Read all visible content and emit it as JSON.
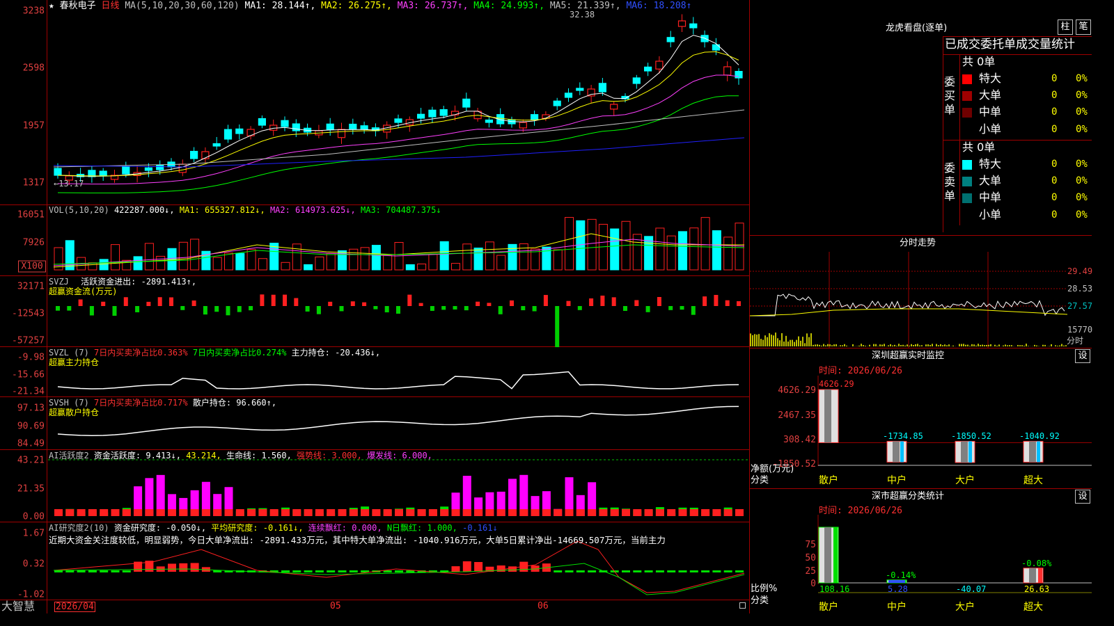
{
  "colors": {
    "up": "#ff2020",
    "down": "#00ffff",
    "ma1": "#ffffff",
    "ma2": "#ffff00",
    "ma3": "#ff40ff",
    "ma4": "#00ff00",
    "ma5": "#c0c0c0",
    "ma6": "#2020ff",
    "axis": "#a00000"
  },
  "main": {
    "star": "★",
    "stock_name": "春秋电子",
    "period": "日线",
    "ma_params": "MA(5,10,20,30,60,120)",
    "ma1": "MA1: 28.144↑,",
    "ma2": "MA2: 26.275↑,",
    "ma3": "MA3: 26.737↑,",
    "ma4": "MA4: 24.993↑,",
    "ma5": "MA5: 21.339↑,",
    "ma6": "MA6: 18.208↑",
    "high_mark": "32.38",
    "low_mark": "←13.17",
    "y_ticks": [
      "3238",
      "2598",
      "1957",
      "1317"
    ]
  },
  "vol": {
    "title": "VOL(5,10,20)",
    "value": "422287.000↓,",
    "ma1": "MA1: 655327.812↓,",
    "ma2": "MA2: 614973.625↓,",
    "ma3": "MA3: 704487.375↓",
    "y_ticks": [
      "16051",
      "7926",
      "X100"
    ]
  },
  "svzj": {
    "title": "SVZJ",
    "label": "活跃资金进出: -2891.413↑,",
    "subtitle": "超赢资金流(万元)",
    "y_ticks": [
      "32171",
      "-12543",
      "-57257"
    ]
  },
  "svzl": {
    "title": "SVZL (7)",
    "t1": "7日内买卖净占比0.363%",
    "t2": "7日内买卖净占比0.274%",
    "t3": "主力持仓: -20.436↓,",
    "subtitle": "超赢主力持仓",
    "y_ticks": [
      "-9.98",
      "-15.66",
      "-21.34"
    ]
  },
  "svsh": {
    "title": "SVSH (7)",
    "t1": "7日内买卖净占比0.717%",
    "t2": "散户持仓: 96.660↑,",
    "subtitle": "超赢散户持仓",
    "y_ticks": [
      "97.13",
      "90.69",
      "84.49"
    ]
  },
  "ai1": {
    "title": "AI活跃度2",
    "t1": "资金活跃度: 9.413↓,",
    "t2": "43.214,",
    "t3": "生命线: 1.560,",
    "t4": "强势线: 3.000,",
    "t5": "爆发线: 6.000,",
    "y_ticks": [
      "43.21",
      "21.35",
      "0.00"
    ]
  },
  "ai2": {
    "title": "AI研究度2(10)",
    "t1": "资金研究度: -0.050↓,",
    "t2": "平均研究度: -0.161↓,",
    "t3": "连续飘红: 0.000,",
    "t4": "N日飘红: 1.000,",
    "t5": "-0.161↓",
    "comment": "近期大资金关注度较低，明显弱势，今日大单净流出: -2891.433万元，其中特大单净流出: -1040.916万元，大单5日累计净出-14669.507万元，当前主力",
    "y_ticks": [
      "1.67",
      "0.32",
      "-1.02"
    ]
  },
  "bottom": {
    "brand": "大智慧",
    "dates": [
      "2026/04",
      "05",
      "06"
    ]
  },
  "lhb": {
    "title": "龙虎看盘(逐单)",
    "tab1": "柱",
    "tab2": "笔",
    "header": "已成交委托单成交量统计",
    "buy_label": "委买单",
    "sell_label": "委卖单",
    "buy_total": "共 0单",
    "sell_total": "共 0单",
    "rows": [
      {
        "name": "特大",
        "n": "0",
        "pct": "0%"
      },
      {
        "name": "大单",
        "n": "0",
        "pct": "0%"
      },
      {
        "name": "中单",
        "n": "0",
        "pct": "0%"
      },
      {
        "name": "小单",
        "n": "0",
        "pct": "0%"
      }
    ]
  },
  "fenshi": {
    "title": "分时走势",
    "y_ticks": [
      "29.49",
      "28.53",
      "27.57",
      "15770"
    ],
    "unit": "分时"
  },
  "sz_monitor": {
    "title": "深圳超赢实时监控",
    "settings": "设",
    "time": "时间: 2026/06/26",
    "y_ticks": [
      "4626.29",
      "2467.35",
      "308.42",
      "-1850.52"
    ],
    "ylabel": "净额(万元)",
    "xlabel": "分类",
    "categories": [
      "散户",
      "中户",
      "大户",
      "超大"
    ],
    "values": [
      "4626.29",
      "-1734.85",
      "-1850.52",
      "-1040.92"
    ]
  },
  "sz_class": {
    "title": "深市超赢分类统计",
    "settings": "设",
    "time": "时间: 2026/06/26",
    "y_ticks": [
      "75",
      "50",
      "25",
      "0"
    ],
    "ylabel": "比例%",
    "xlabel": "分类",
    "categories": [
      "散户",
      "中户",
      "大户",
      "超大"
    ],
    "values": [
      "108.16",
      "5.28",
      "-40.07",
      "26.63"
    ],
    "top_labels": [
      "-0.14%",
      "-0.08%"
    ]
  }
}
